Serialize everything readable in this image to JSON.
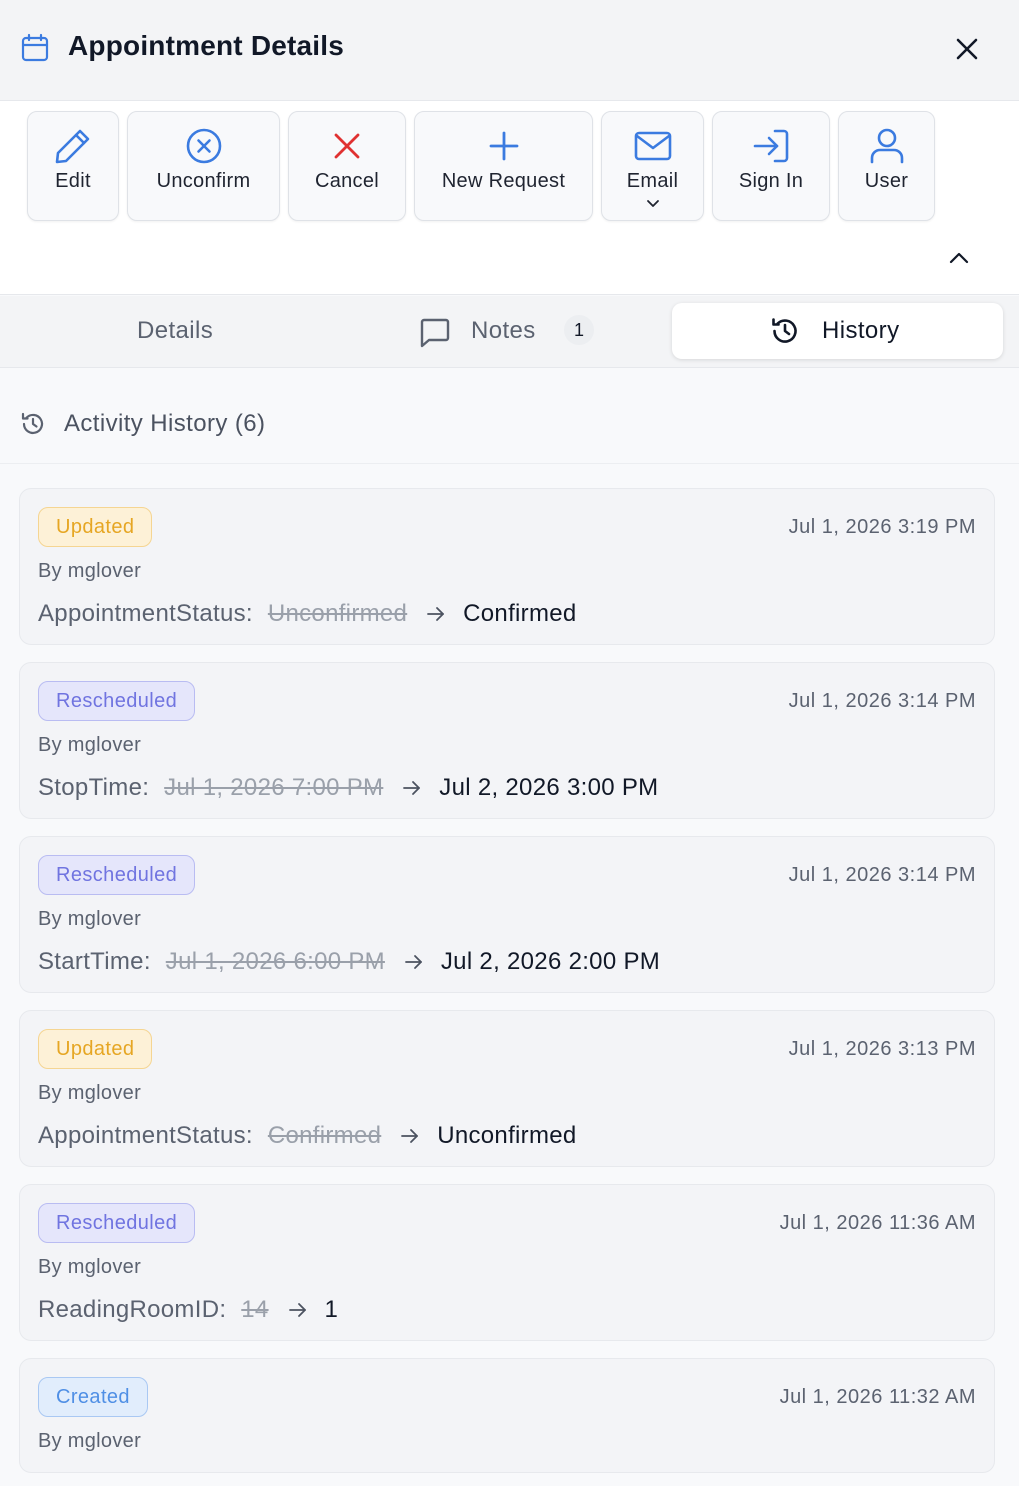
{
  "header": {
    "title": "Appointment Details"
  },
  "toolbar": {
    "edit": "Edit",
    "unconfirm": "Unconfirm",
    "cancel": "Cancel",
    "new_request": "New Request",
    "email": "Email",
    "sign_in": "Sign In",
    "user": "User"
  },
  "tabs": {
    "details": "Details",
    "notes": "Notes",
    "notes_count": "1",
    "history": "History",
    "active": "History"
  },
  "history": {
    "heading": "Activity History (6)",
    "entries": [
      {
        "badge": "Updated",
        "time": "Jul 1, 2026 3:19 PM",
        "by": "By mglover",
        "field": "AppointmentStatus:",
        "old": "Unconfirmed",
        "new": "Confirmed"
      },
      {
        "badge": "Rescheduled",
        "time": "Jul 1, 2026 3:14 PM",
        "by": "By mglover",
        "field": "StopTime:",
        "old": "Jul 1, 2026 7:00 PM",
        "new": "Jul 2, 2026 3:00 PM"
      },
      {
        "badge": "Rescheduled",
        "time": "Jul 1, 2026 3:14 PM",
        "by": "By mglover",
        "field": "StartTime:",
        "old": "Jul 1, 2026 6:00 PM",
        "new": "Jul 2, 2026 2:00 PM"
      },
      {
        "badge": "Updated",
        "time": "Jul 1, 2026 3:13 PM",
        "by": "By mglover",
        "field": "AppointmentStatus:",
        "old": "Confirmed",
        "new": "Unconfirmed"
      },
      {
        "badge": "Rescheduled",
        "time": "Jul 1, 2026 11:36 AM",
        "by": "By mglover",
        "field": "ReadingRoomID:",
        "old": "14",
        "new": "1"
      },
      {
        "badge": "Created",
        "time": "Jul 1, 2026 11:32 AM",
        "by": "By mglover"
      }
    ]
  },
  "colors": {
    "accent_blue": "#3b7be0",
    "cancel_red": "#e03131",
    "updated_badge": "#e6a623",
    "rescheduled_badge": "#7074e0",
    "created_badge": "#4f8fe5"
  },
  "icons": {
    "header": "calendar-icon",
    "close": "close-icon",
    "edit": "pencil-icon",
    "unconfirm": "circle-x-icon",
    "cancel": "x-icon",
    "new_request": "plus-icon",
    "email": "mail-icon",
    "sign_in": "sign-in-icon",
    "user": "user-icon",
    "history": "history-icon",
    "notes": "message-square-icon"
  }
}
